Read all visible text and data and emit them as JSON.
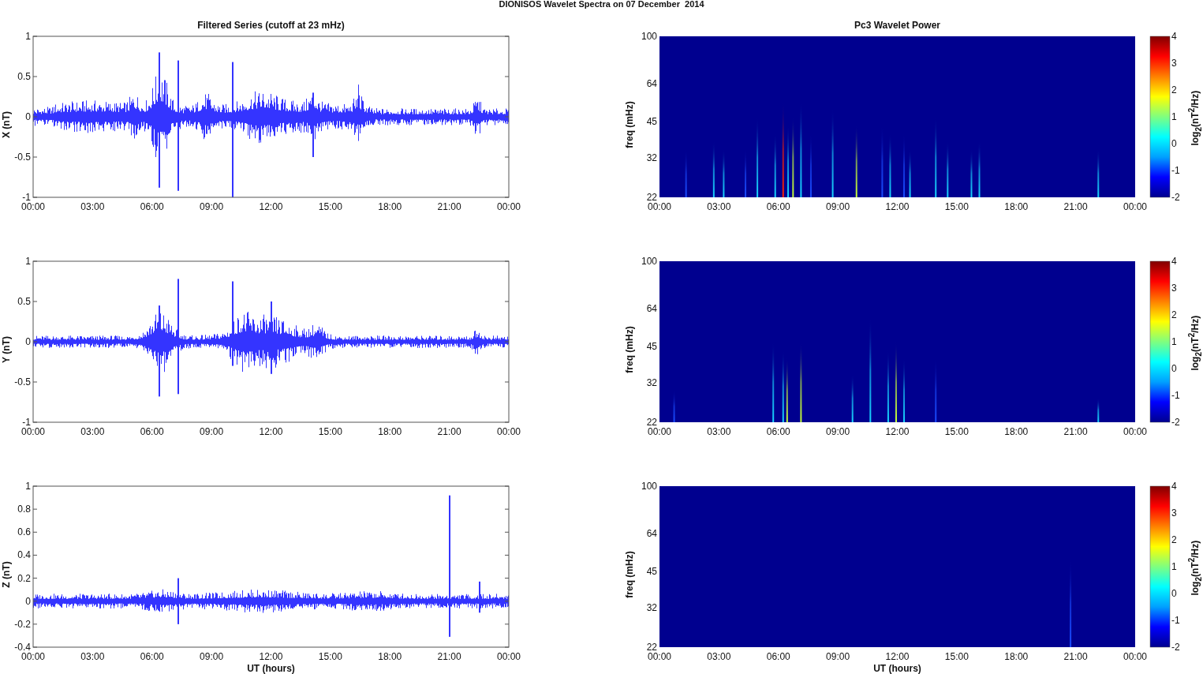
{
  "figure": {
    "title": "DIONISOS Wavelet Spectra on 07 December  2014"
  },
  "rows": [
    {
      "series": {
        "title": "Filtered Series (cutoff at 23 mHz)",
        "ylabel": "X (nT)",
        "yticks": [
          "1",
          "0.5",
          "0",
          "-0.5",
          "-1"
        ],
        "xticks": [
          "00:00",
          "03:00",
          "06:00",
          "09:00",
          "12:00",
          "15:00",
          "18:00",
          "21:00",
          "00:00"
        ]
      },
      "spectrum": {
        "title": "Pc3 Wavelet Power",
        "ylabel": "freq (mHz)",
        "yticks": [
          "100",
          "64",
          "45",
          "32",
          "22"
        ],
        "xticks": [
          "00:00",
          "03:00",
          "06:00",
          "09:00",
          "12:00",
          "15:00",
          "18:00",
          "21:00",
          "00:00"
        ],
        "colorbar": {
          "ticks": [
            "4",
            "3",
            "2",
            "1",
            "0",
            "-1",
            "-2"
          ],
          "label": "log$_{2}$(nT$^{2}$/Hz)"
        }
      }
    },
    {
      "series": {
        "ylabel": "Y (nT)",
        "yticks": [
          "1",
          "0.5",
          "0",
          "-0.5",
          "-1"
        ],
        "xticks": [
          "00:00",
          "03:00",
          "06:00",
          "09:00",
          "12:00",
          "15:00",
          "18:00",
          "21:00",
          "00:00"
        ]
      },
      "spectrum": {
        "ylabel": "freq (mHz)",
        "yticks": [
          "100",
          "64",
          "45",
          "32",
          "22"
        ],
        "xticks": [
          "00:00",
          "03:00",
          "06:00",
          "09:00",
          "12:00",
          "15:00",
          "18:00",
          "21:00",
          "00:00"
        ],
        "colorbar": {
          "ticks": [
            "4",
            "3",
            "2",
            "1",
            "0",
            "-1",
            "-2"
          ],
          "label": "log$_{2}$(nT$^{2}$/Hz)"
        }
      }
    },
    {
      "series": {
        "ylabel": "Z (nT)",
        "yticks": [
          "1",
          "0.8",
          "0.6",
          "0.4",
          "0.2",
          "0",
          "-0.2",
          "-0.4"
        ],
        "xticks": [
          "00:00",
          "03:00",
          "06:00",
          "09:00",
          "12:00",
          "15:00",
          "18:00",
          "21:00",
          "00:00"
        ],
        "xlabel": "UT (hours)"
      },
      "spectrum": {
        "ylabel": "freq (mHz)",
        "yticks": [
          "100",
          "64",
          "45",
          "32",
          "22"
        ],
        "xticks": [
          "00:00",
          "03:00",
          "06:00",
          "09:00",
          "12:00",
          "15:00",
          "18:00",
          "21:00",
          "00:00"
        ],
        "xlabel": "UT (hours)",
        "colorbar": {
          "ticks": [
            "4",
            "3",
            "2",
            "1",
            "0",
            "-1",
            "-2"
          ],
          "label": "log$_{2}$(nT$^{2}$/Hz)"
        }
      }
    }
  ]
}
